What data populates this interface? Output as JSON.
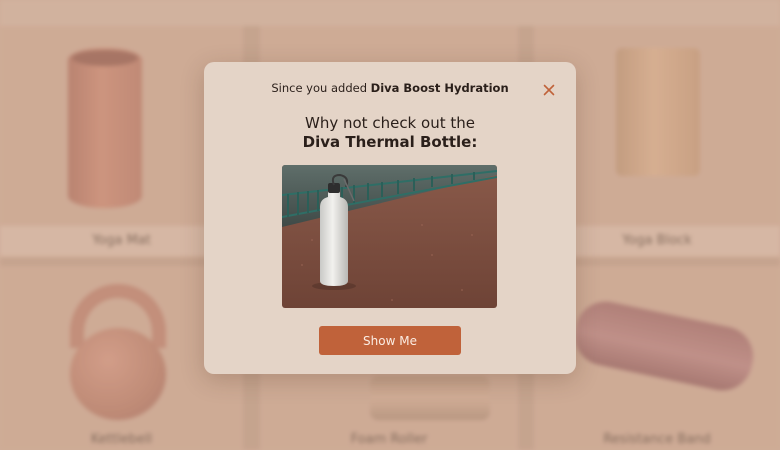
{
  "products": [
    {
      "name": "Yoga Mat",
      "icon": "yoga-mat-image"
    },
    {
      "name": "Yoga Block",
      "icon": "yoga-block-image"
    },
    {
      "name": "Kettlebell",
      "icon": "kettlebell-image"
    },
    {
      "name": "Foam Roller",
      "icon": "foam-roller-image"
    },
    {
      "name": "Resistance Band",
      "icon": "resistance-band-image"
    }
  ],
  "modal": {
    "header_prefix": "Since you added ",
    "added_product": "Diva Boost Hydration",
    "heading_line1": "Why not check out the",
    "heading_line2": "Diva Thermal Bottle:",
    "image_icon": "water-bottle-photo",
    "button_label": "Show Me",
    "close_icon": "close-icon"
  },
  "colors": {
    "accent": "#c0623a",
    "modal_background": "#e4d4c7",
    "page_background": "#c59d86"
  }
}
